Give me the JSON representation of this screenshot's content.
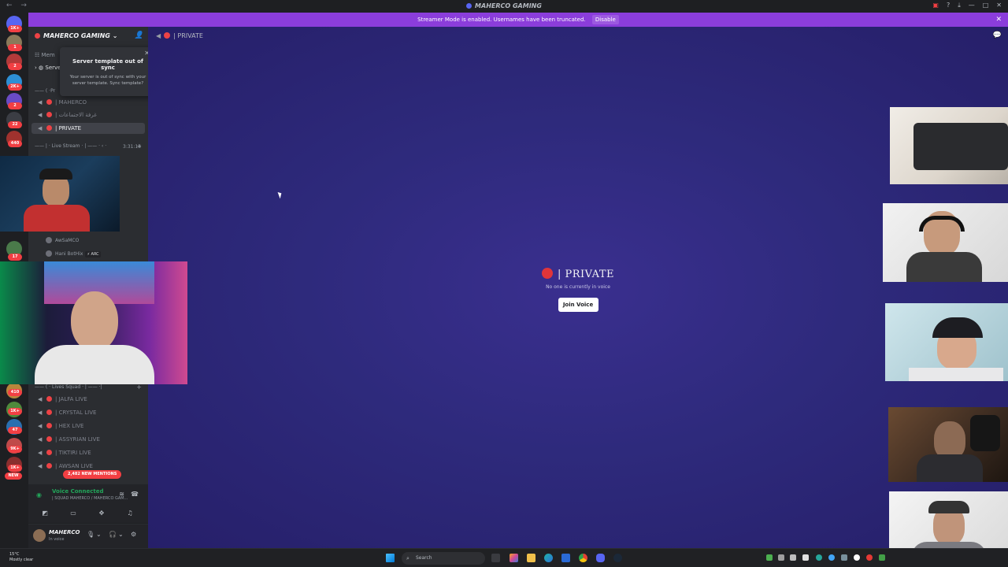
{
  "titlebar": {
    "title": "MAHERCO GAMING",
    "nav": "← →"
  },
  "banner": {
    "message": "Streamer Mode is enabled. Usernames have been truncated.",
    "disable_label": "Disable",
    "close": "✕"
  },
  "guilds": {
    "badges": [
      "1K+",
      "1",
      "2",
      "2K+",
      "2",
      "22",
      "440",
      "17",
      "410",
      "1K+",
      "47",
      "9K+",
      "1K+",
      "NEW"
    ]
  },
  "sidebar": {
    "server_name": "MAHERCO GAMING",
    "nav_items": [
      "Mem",
      "Serve"
    ],
    "categories": [
      "—— ( ·Pr",
      "—— | · Live Stream · | —— · ‹ ·",
      "—— ( · Lives Squad · | —— ·|"
    ],
    "channels_top": [
      "| MAHERCO",
      "| غرفة الاجتماعات",
      "| PRIVATE"
    ],
    "voice_users": [
      {
        "name": "AwSaMCO",
        "tag": ""
      },
      {
        "name": "Hani BotHix",
        "tag": "⚡ ARC"
      }
    ],
    "timer": "3:31:14",
    "channels_bottom": [
      "| JALFA LIVE",
      "| CRYSTAL LIVE",
      "| HEX LIVE",
      "| ASSYRIAN LIVE",
      "| TIKTIRI LIVE",
      "| AWSAN LIVE"
    ],
    "mentions_badge": "2,482 NEW MENTIONS"
  },
  "popup": {
    "title": "Server template out of sync",
    "body": "Your server is out of sync with your server template. Sync template?",
    "close": "✕"
  },
  "voice_panel": {
    "title": "Voice Connected",
    "subtitle": "| SQUAD MAHERCO / MAHERCO GAM..."
  },
  "user_panel": {
    "name": "MAHERCO",
    "status": "In voice"
  },
  "main": {
    "channel_name": "| PRIVATE",
    "big_title": "| PRIVATE",
    "subtitle": "No one is currently in voice",
    "join_label": "Join Voice"
  },
  "taskbar": {
    "temperature": "15°C",
    "weather": "Mostly clear",
    "search_placeholder": "Search"
  },
  "colors": {
    "accent": "#5865f2",
    "banner": "#8b3ddb",
    "danger": "#ed4245",
    "connected": "#23a55a"
  }
}
